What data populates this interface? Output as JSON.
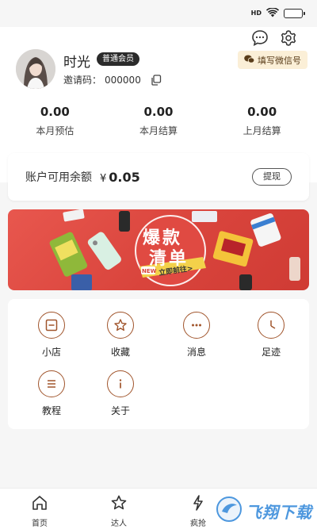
{
  "status_bar": {
    "network": "HD",
    "battery_label": "battery"
  },
  "profile": {
    "name": "时光",
    "member_level": "普通会员",
    "invite_code_label": "邀请码：",
    "invite_code": "000000",
    "wechat_button": "填写微信号"
  },
  "stats": [
    {
      "value": "0.00",
      "label": "本月预估"
    },
    {
      "value": "0.00",
      "label": "本月结算"
    },
    {
      "value": "0.00",
      "label": "上月结算"
    }
  ],
  "balance": {
    "label": "账户可用余额",
    "currency": "¥",
    "amount": "0.05",
    "withdraw_label": "提现"
  },
  "banner": {
    "title_line1": "爆款",
    "title_line2": "清单",
    "new_badge": "NEW",
    "cta": "立即前往>"
  },
  "menu": [
    {
      "label": "小店",
      "icon": "shop-icon"
    },
    {
      "label": "收藏",
      "icon": "star-icon"
    },
    {
      "label": "消息",
      "icon": "message-icon"
    },
    {
      "label": "足迹",
      "icon": "clock-icon"
    },
    {
      "label": "教程",
      "icon": "list-icon"
    },
    {
      "label": "关于",
      "icon": "info-icon"
    }
  ],
  "tabbar": [
    {
      "label": "首页",
      "icon": "home-icon"
    },
    {
      "label": "达人",
      "icon": "star-icon"
    },
    {
      "label": "疯抢",
      "icon": "lightning-icon"
    }
  ],
  "watermark": {
    "text": "飞翔下载"
  },
  "colors": {
    "accent": "#a0542b",
    "banner": "#d9443c",
    "wechat_bg": "#fbefd7"
  }
}
